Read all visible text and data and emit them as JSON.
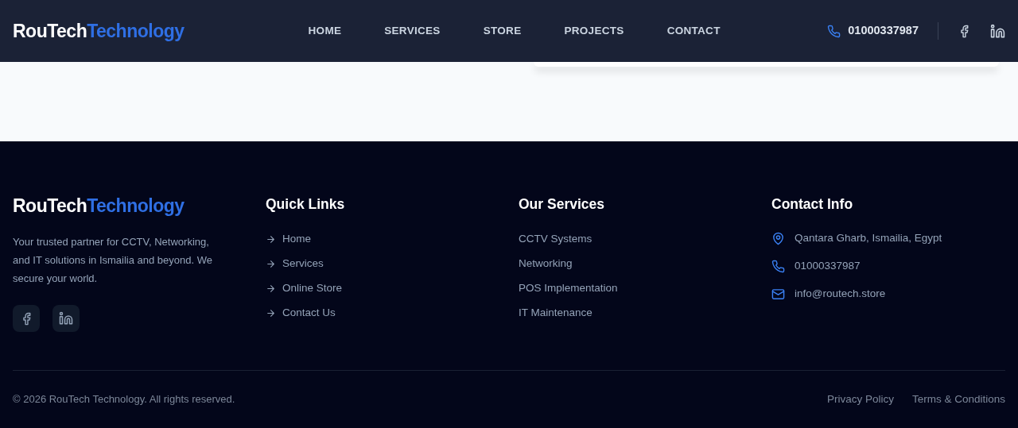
{
  "header": {
    "logo": {
      "main": "RouTech",
      "accent": "Technology"
    },
    "nav": [
      {
        "label": "HOME"
      },
      {
        "label": "SERVICES"
      },
      {
        "label": "STORE"
      },
      {
        "label": "PROJECTS"
      },
      {
        "label": "CONTACT"
      }
    ],
    "phone": "01000337987"
  },
  "footer": {
    "logo": {
      "main": "RouTech",
      "accent": "Technology"
    },
    "about": "Your trusted partner for CCTV, Networking, and IT solutions in Ismailia and beyond. We secure your world.",
    "quick_links": {
      "title": "Quick Links",
      "items": [
        "Home",
        "Services",
        "Online Store",
        "Contact Us"
      ]
    },
    "services": {
      "title": "Our Services",
      "items": [
        "CCTV Systems",
        "Networking",
        "POS Implementation",
        "IT Maintenance"
      ]
    },
    "contact": {
      "title": "Contact Info",
      "items": [
        {
          "kind": "address",
          "text": "Qantara Gharb, Ismailia, Egypt"
        },
        {
          "kind": "phone",
          "text": "01000337987"
        },
        {
          "kind": "email",
          "text": "info@routech.store"
        }
      ]
    },
    "copyright": "© 2026 RouTech Technology. All rights reserved.",
    "legal_links": [
      "Privacy Policy",
      "Terms & Conditions"
    ]
  }
}
